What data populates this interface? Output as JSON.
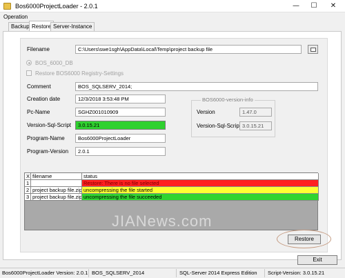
{
  "window": {
    "title": "Bos6000ProjectLoader - 2.0.1",
    "minimize_glyph": "—",
    "maximize_glyph": "☐",
    "close_glyph": "✕"
  },
  "menu": {
    "items": [
      {
        "label": "Operation"
      }
    ]
  },
  "tabs": [
    {
      "label": "Backup",
      "active": false
    },
    {
      "label": "Restore",
      "active": true
    },
    {
      "label": "Server-Instance",
      "active": false
    }
  ],
  "form": {
    "filename_label": "Filename",
    "filename_value": "C:\\Users\\swe1sgh\\AppData\\Local\\Temp\\project backup file",
    "radio_label": "BOS_6000_DB",
    "checkbox_label": "Restore BOS6000 Registry-Settings",
    "comment_label": "Comment",
    "comment_value": "BOS_SQLSERV_2014;",
    "creation_date_label": "Creation date",
    "creation_date_value": "12/3/2018 3:53:48 PM",
    "pc_name_label": "Pc-Name",
    "pc_name_value": "SGHZ001010909",
    "version_sql_script_label": "Version-Sql-Script",
    "version_sql_script_value": "3.0.15.21",
    "program_name_label": "Program-Name",
    "program_name_value": "Bos6000ProjectLoader",
    "program_version_label": "Program-Version",
    "program_version_value": "2.0.1"
  },
  "version_info": {
    "title": "BOS6000-version-info",
    "version_label": "Version",
    "version_value": "1.47.0",
    "sql_script_label": "Version-Sql-Script",
    "sql_script_value": "3.0.15.21"
  },
  "table": {
    "headers": [
      "X",
      "filename",
      "status"
    ],
    "rows": [
      {
        "x": "1",
        "filename": "",
        "status": "Restore: There is no file selected",
        "color": "#ff2020"
      },
      {
        "x": "2",
        "filename": "project backup file.zip",
        "status": "uncompressing the file started",
        "color": "#ffff33"
      },
      {
        "x": "3",
        "filename": "project backup file.zip",
        "status": "uncompressing the file succeeded",
        "color": "#30d430"
      }
    ]
  },
  "buttons": {
    "restore": "Restore",
    "exit": "Exit"
  },
  "status_bar": [
    "Bos6000ProjectLoader Version: 2.0.1",
    "BOS_SQLSERV_2014",
    "SQL-Server 2014 Express Edition",
    "Script-Version: 3.0.15.21"
  ],
  "watermark": "JIANews.com",
  "icons": {
    "app": "folder-icon",
    "browse": "browse-folder-icon"
  }
}
